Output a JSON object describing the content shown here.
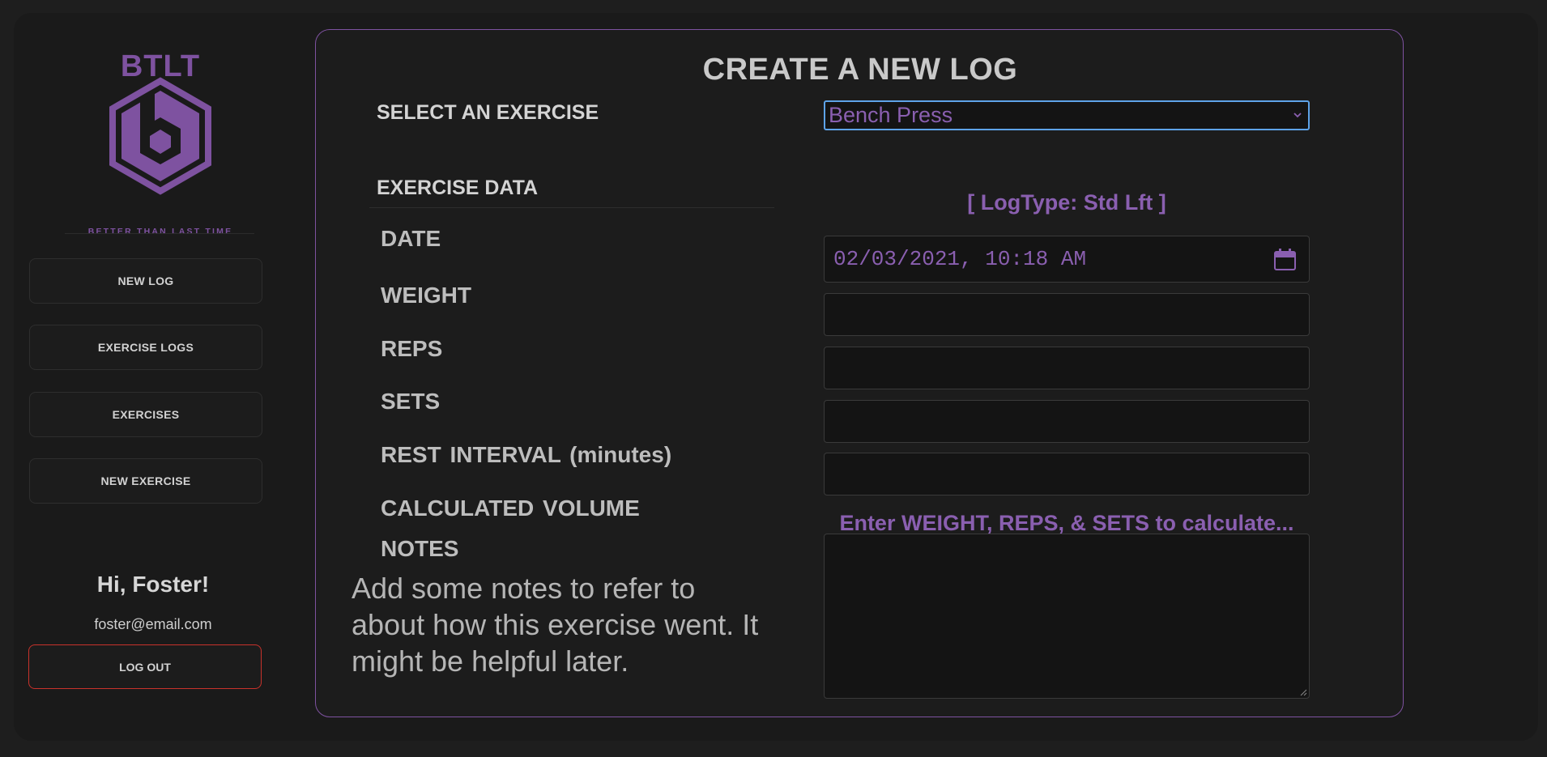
{
  "brand": {
    "name": "BTLT",
    "tagline": "BETTER THAN LAST TIME",
    "color": "#7e52a0"
  },
  "nav": {
    "items": [
      {
        "label": "NEW LOG"
      },
      {
        "label": "EXERCISE LOGS"
      },
      {
        "label": "EXERCISES"
      },
      {
        "label": "NEW EXERCISE"
      }
    ]
  },
  "user": {
    "greeting": "Hi, Foster!",
    "email": "foster@email.com",
    "logout_label": "LOG OUT"
  },
  "form": {
    "title": "CREATE A NEW LOG",
    "select_label": "SELECT AN EXERCISE",
    "selected_exercise": "Bench Press",
    "section_label": "EXERCISE DATA",
    "log_type": "[ LogType: Std Lft ]",
    "fields": {
      "date_label": "DATE",
      "date_value": "02/03/2021, 10:18 AM",
      "weight_label": "WEIGHT",
      "weight_value": "",
      "reps_label": "REPS",
      "reps_value": "",
      "sets_label": "SETS",
      "sets_value": "",
      "rest_label": "REST INTERVAL (minutes)",
      "rest_value": "",
      "volume_label": "CALCULATED VOLUME",
      "volume_value": "Enter WEIGHT, REPS, & SETS to calculate...",
      "notes_label": "NOTES",
      "notes_hint": "Add some notes to refer to about how this exercise went. It might be helpful later.",
      "notes_value": ""
    }
  },
  "colors": {
    "accent": "#7e52a0",
    "focus": "#5ea3e8",
    "logout_border": "#c8322b"
  }
}
